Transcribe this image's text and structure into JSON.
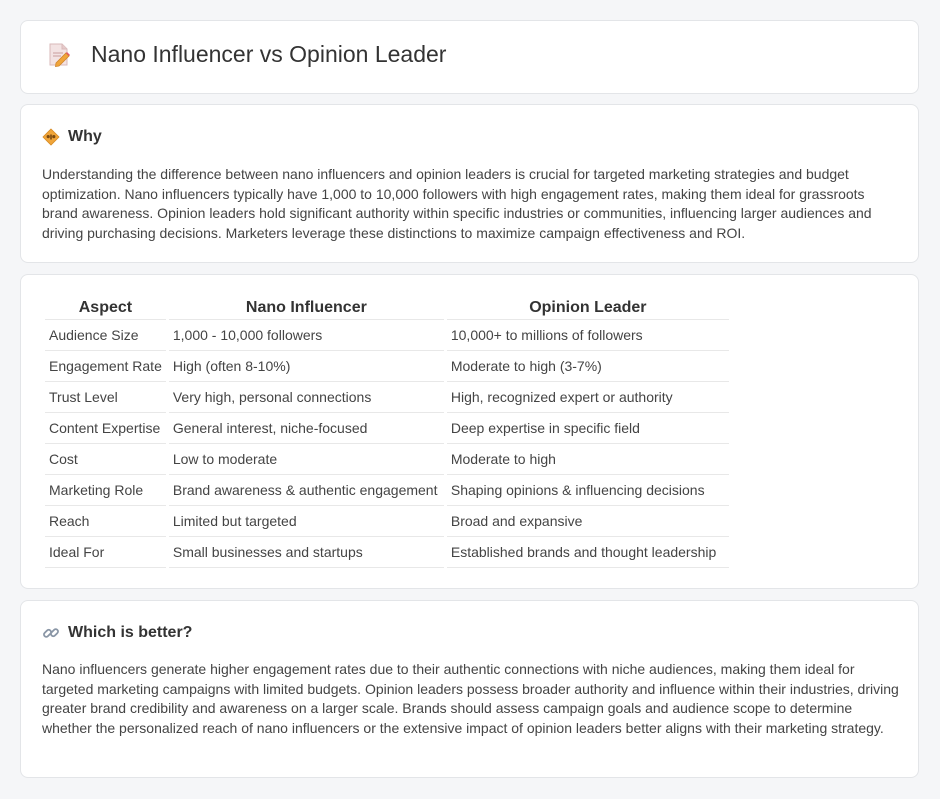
{
  "page": {
    "title": "Nano Influencer vs Opinion Leader",
    "title_icon": "document-edit-icon"
  },
  "why": {
    "heading": "Why",
    "icon": "diamond-sign-icon",
    "text": "Understanding the difference between nano influencers and opinion leaders is crucial for targeted marketing strategies and budget optimization. Nano influencers typically have 1,000 to 10,000 followers with high engagement rates, making them ideal for grassroots brand awareness. Opinion leaders hold significant authority within specific industries or communities, influencing larger audiences and driving purchasing decisions. Marketers leverage these distinctions to maximize campaign effectiveness and ROI."
  },
  "comparison": {
    "headers": [
      "Aspect",
      "Nano Influencer",
      "Opinion Leader"
    ],
    "rows": [
      [
        "Audience Size",
        "1,000 - 10,000 followers",
        "10,000+ to millions of followers"
      ],
      [
        "Engagement Rate",
        "High (often 8-10%)",
        "Moderate to high (3-7%)"
      ],
      [
        "Trust Level",
        "Very high, personal connections",
        "High, recognized expert or authority"
      ],
      [
        "Content Expertise",
        "General interest, niche-focused",
        "Deep expertise in specific field"
      ],
      [
        "Cost",
        "Low to moderate",
        "Moderate to high"
      ],
      [
        "Marketing Role",
        "Brand awareness & authentic engagement",
        "Shaping opinions & influencing decisions"
      ],
      [
        "Reach",
        "Limited but targeted",
        "Broad and expansive"
      ],
      [
        "Ideal For",
        "Small businesses and startups",
        "Established brands and thought leadership"
      ]
    ]
  },
  "better": {
    "heading": "Which is better?",
    "icon": "link-icon",
    "text": "Nano influencers generate higher engagement rates due to their authentic connections with niche audiences, making them ideal for targeted marketing campaigns with limited budgets. Opinion leaders possess broader authority and influence within their industries, driving greater brand credibility and awareness on a larger scale. Brands should assess campaign goals and audience scope to determine whether the personalized reach of nano influencers or the extensive impact of opinion leaders better aligns with their marketing strategy."
  },
  "colors": {
    "background": "#f5f6f8",
    "card": "#ffffff",
    "border": "#e3e5e8",
    "accent_orange": "#f0a53a"
  }
}
